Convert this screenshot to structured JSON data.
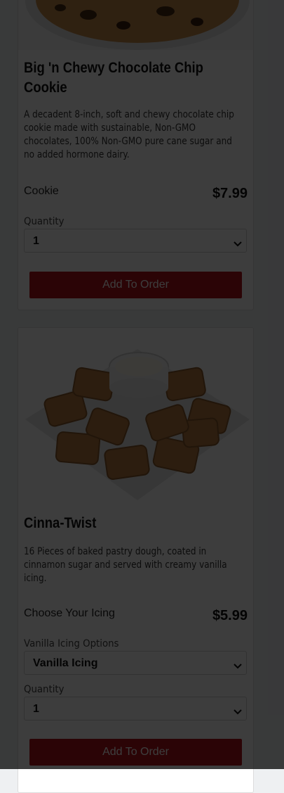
{
  "items": [
    {
      "name": "Big 'n Chewy Chocolate Chip Cookie",
      "description": "A decadent 8-inch, soft and chewy chocolate chip cookie made with sustainable, Non-GMO chocolates, 100% Non-GMO pure cane sugar and no added hormone dairy.",
      "option_name": "Cookie",
      "price": "$7.99",
      "quantity_label": "Quantity",
      "quantity_value": "1",
      "add_button_label": "Add To Order"
    },
    {
      "name": "Cinna-Twist",
      "description": "16 Pieces of baked pastry dough, coated in cinnamon sugar and served with creamy vanilla icing.",
      "option_name": "Choose Your Icing",
      "price": "$5.99",
      "icing_label": "Vanilla Icing Options",
      "icing_value": "Vanilla Icing",
      "quantity_label": "Quantity",
      "quantity_value": "1",
      "add_button_label": "Add To Order"
    }
  ],
  "colors": {
    "accent": "#b3131b",
    "overlay": "rgba(0,0,0,0.76)",
    "page_background": "#eef0f2"
  },
  "icons": [
    "chevron-down-icon"
  ]
}
